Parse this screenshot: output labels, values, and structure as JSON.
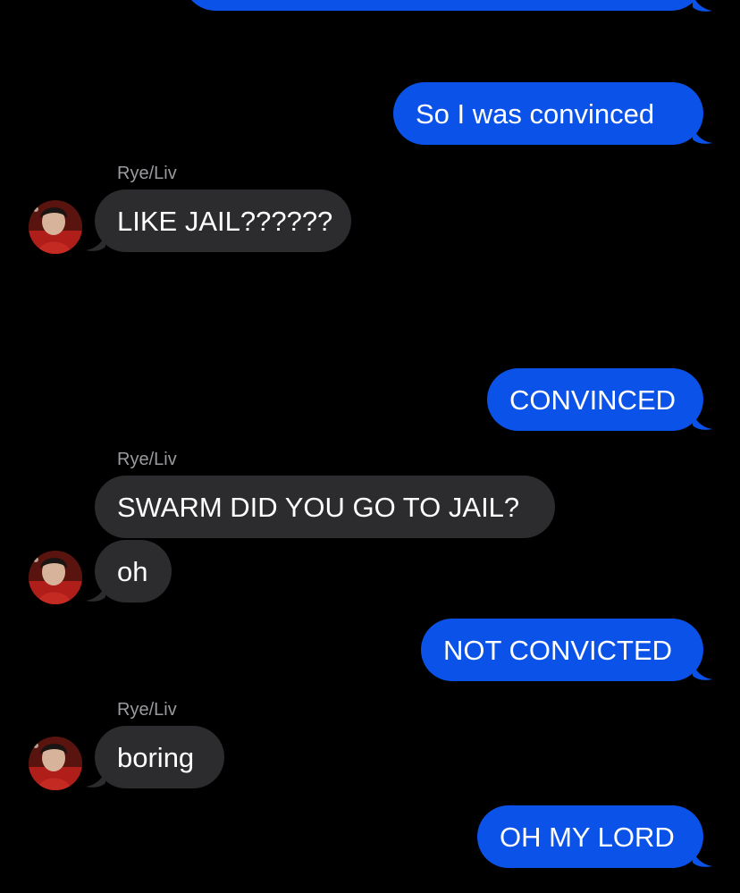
{
  "colors": {
    "background": "#000000",
    "sent_bubble": "#0b52e8",
    "received_bubble": "#2c2c2e",
    "sender_name": "#9a9a9f",
    "text": "#ffffff"
  },
  "conversation": {
    "messages": [
      {
        "direction": "outgoing",
        "text": ""
      },
      {
        "direction": "outgoing",
        "text": "So I was convinced"
      },
      {
        "direction": "incoming",
        "sender": "Rye/Liv",
        "text": "LIKE JAIL??????"
      },
      {
        "direction": "outgoing",
        "text": "CONVINCED"
      },
      {
        "direction": "incoming",
        "sender": "Rye/Liv",
        "text": "SWARM DID YOU GO TO JAIL?"
      },
      {
        "direction": "incoming",
        "text": "oh"
      },
      {
        "direction": "outgoing",
        "text": "NOT CONVICTED"
      },
      {
        "direction": "incoming",
        "sender": "Rye/Liv",
        "text": "boring"
      },
      {
        "direction": "outgoing",
        "text": "OH MY LORD"
      }
    ]
  }
}
